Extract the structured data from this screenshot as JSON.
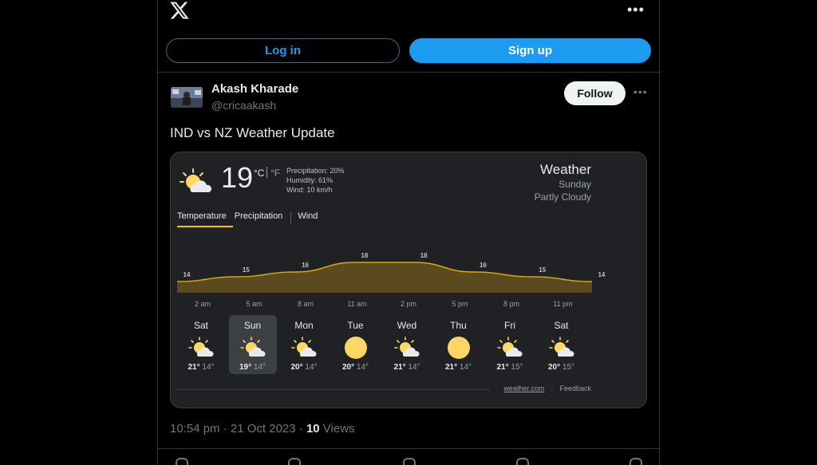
{
  "topbar": {
    "more_label": "•••"
  },
  "auth": {
    "login_label": "Log in",
    "signup_label": "Sign up"
  },
  "tweet": {
    "author_name": "Akash Kharade",
    "author_handle": "@cricaakash",
    "follow_label": "Follow",
    "more_label": "•••",
    "text": "IND vs NZ Weather Update",
    "time_date": "10:54 pm · 21 Oct 2023 · ",
    "views_count": "10",
    "views_label": " Views"
  },
  "weather": {
    "current_temp": "19",
    "unit_c": "°C",
    "unit_f": "°F",
    "precipitation": "Precipitation: 20%",
    "humidity": "Humidity: 61%",
    "wind": "Wind: 10 km/h",
    "title": "Weather",
    "day": "Sunday",
    "condition": "Partly Cloudy",
    "tabs": [
      "Temperature",
      "Precipitation",
      "Wind"
    ],
    "footer_source": "weather.com",
    "footer_dot": "·",
    "footer_feedback": "Feedback",
    "colors": {
      "accent": "#fbbc04",
      "fill": "#5b4a1f",
      "line": "#e0a800",
      "sun": "#fdd663"
    },
    "days": [
      {
        "name": "Sat",
        "icon": "partly-cloudy-icon",
        "hi": "21°",
        "lo": "14°"
      },
      {
        "name": "Sun",
        "icon": "partly-cloudy-icon",
        "hi": "19°",
        "lo": "14°",
        "selected": true
      },
      {
        "name": "Mon",
        "icon": "partly-cloudy-icon",
        "hi": "20°",
        "lo": "14°"
      },
      {
        "name": "Tue",
        "icon": "sunny-icon",
        "hi": "20°",
        "lo": "14°"
      },
      {
        "name": "Wed",
        "icon": "partly-cloudy-icon",
        "hi": "21°",
        "lo": "14°"
      },
      {
        "name": "Thu",
        "icon": "sunny-icon",
        "hi": "21°",
        "lo": "14°"
      },
      {
        "name": "Fri",
        "icon": "partly-cloudy-icon",
        "hi": "21°",
        "lo": "15°"
      },
      {
        "name": "Sat",
        "icon": "partly-cloudy-icon",
        "hi": "20°",
        "lo": "15°"
      }
    ]
  },
  "chart_data": {
    "type": "area",
    "x": [
      "2 am",
      "5 am",
      "8 am",
      "11 am",
      "2 pm",
      "5 pm",
      "8 pm",
      "11 pm"
    ],
    "values": [
      14,
      15,
      16,
      18,
      18,
      16,
      15,
      14
    ],
    "labels": [
      "14",
      "15",
      "16",
      "18",
      "18",
      "16",
      "15",
      "14"
    ]
  }
}
